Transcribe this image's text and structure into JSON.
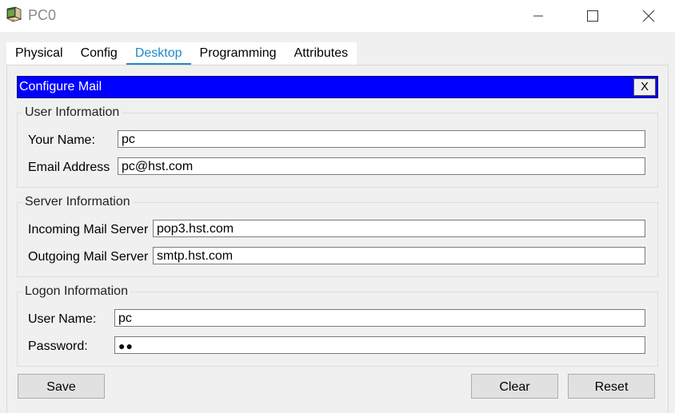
{
  "window": {
    "title": "PC0",
    "icon": "pc-icon"
  },
  "tabs": [
    {
      "label": "Physical",
      "active": false
    },
    {
      "label": "Config",
      "active": false
    },
    {
      "label": "Desktop",
      "active": true
    },
    {
      "label": "Programming",
      "active": false
    },
    {
      "label": "Attributes",
      "active": false
    }
  ],
  "dialog": {
    "title": "Configure Mail",
    "close_label": "X",
    "header_color": "#0000ff"
  },
  "user_info": {
    "group_label": "User Information",
    "name_label": "Your Name:",
    "name_value": "pc",
    "email_label": "Email Address",
    "email_value": "pc@hst.com"
  },
  "server_info": {
    "group_label": "Server Information",
    "incoming_label": "Incoming Mail Server",
    "incoming_value": "pop3.hst.com",
    "outgoing_label": "Outgoing Mail Server",
    "outgoing_value": "smtp.hst.com"
  },
  "logon_info": {
    "group_label": "Logon Information",
    "username_label": "User Name:",
    "username_value": "pc",
    "password_label": "Password:",
    "password_value": "●●"
  },
  "buttons": {
    "save": "Save",
    "clear": "Clear",
    "reset": "Reset"
  },
  "colors": {
    "accent": "#1f8ac6",
    "panel_bg": "#f0f0f0"
  }
}
